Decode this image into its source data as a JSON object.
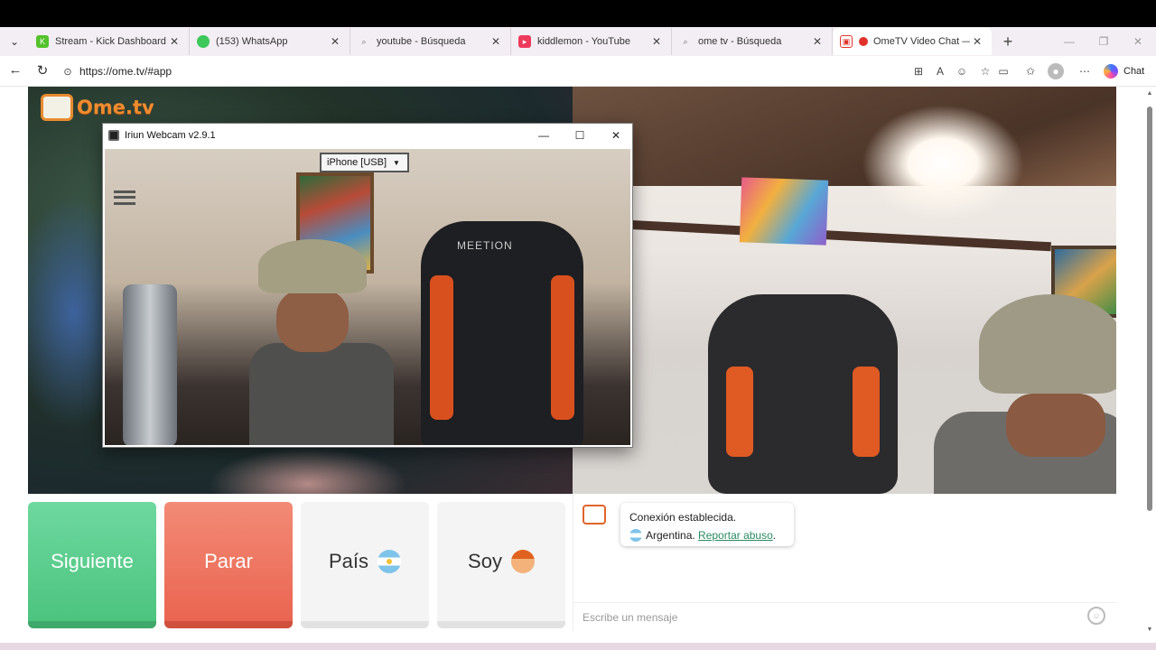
{
  "browser": {
    "tabs": [
      {
        "title": "Stream - Kick Dashboard",
        "favicon": "kick-icon",
        "color": "#53c22b"
      },
      {
        "title": "(153) WhatsApp",
        "favicon": "whatsapp-icon",
        "color": "#3cc85a"
      },
      {
        "title": "youtube - Búsqueda",
        "favicon": "search-icon",
        "color": ""
      },
      {
        "title": "kiddlemon - YouTube",
        "favicon": "youtube-icon",
        "color": "#ee3a5c"
      },
      {
        "title": "ome tv - Búsqueda",
        "favicon": "search-icon",
        "color": ""
      },
      {
        "title": "OmeTV Video Chat — O",
        "favicon": "ometv-icon",
        "color": "#e0322b",
        "active": true
      }
    ],
    "url": "https://ome.tv/#app",
    "chat_label": "Chat"
  },
  "site": {
    "logo_text": "Ome.tv",
    "logo_badge": "Ome TV"
  },
  "iriun": {
    "title": "Iriun Webcam v2.9.1",
    "device_selected": "iPhone [USB]",
    "chair_brand": "MEETION"
  },
  "controls": {
    "next_label": "Siguiente",
    "stop_label": "Parar",
    "country_label": "País",
    "gender_label": "Soy"
  },
  "chat": {
    "system_line1": "Conexión establecida.",
    "country": "Argentina.",
    "report_link": "Reportar abuso",
    "report_suffix": ".",
    "input_placeholder": "Escribe un mensaje"
  },
  "colors": {
    "next": "#4cc47f",
    "stop": "#ea6551",
    "brand": "#f08c2f"
  }
}
